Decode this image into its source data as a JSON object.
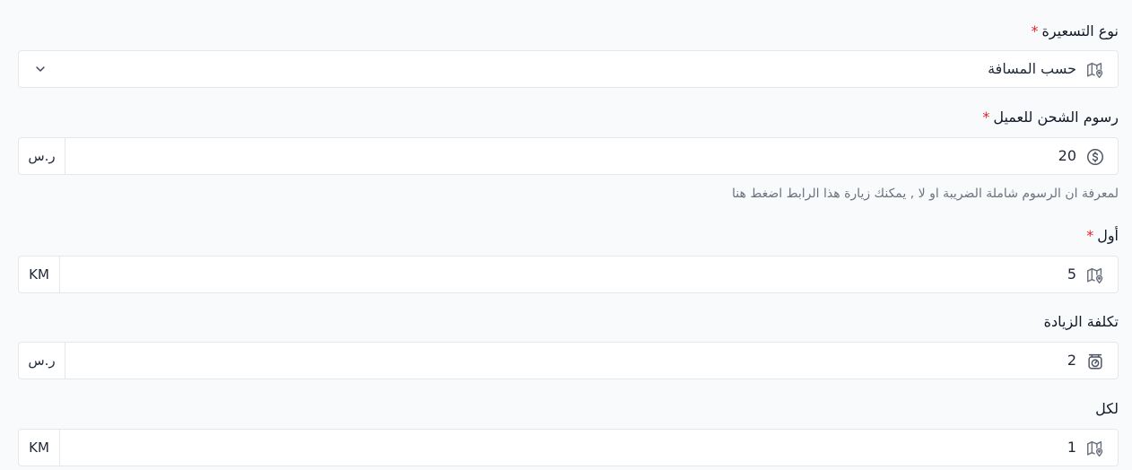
{
  "pricing_type": {
    "label": "نوع التسعيرة",
    "required_mark": "*",
    "value": "حسب المسافة",
    "icon": "map-pin-icon"
  },
  "customer_shipping_fee": {
    "label": "رسوم الشحن للعميل",
    "required_mark": "*",
    "value": "20",
    "unit": "ر.س",
    "icon": "dollar-circle-icon",
    "hint": "لمعرفة ان الرسوم شاملة الضريبة او لا , يمكنك زيارة هذا الرابط اضغط هنا"
  },
  "first": {
    "label": "أول",
    "required_mark": "*",
    "value": "5",
    "unit": "KM",
    "icon": "map-pin-icon"
  },
  "extra_cost": {
    "label": "تكلفة الزيادة",
    "value": "2",
    "unit": "ر.س",
    "icon": "scale-icon"
  },
  "per": {
    "label": "لكل",
    "value": "1",
    "unit": "KM",
    "icon": "map-pin-icon"
  }
}
